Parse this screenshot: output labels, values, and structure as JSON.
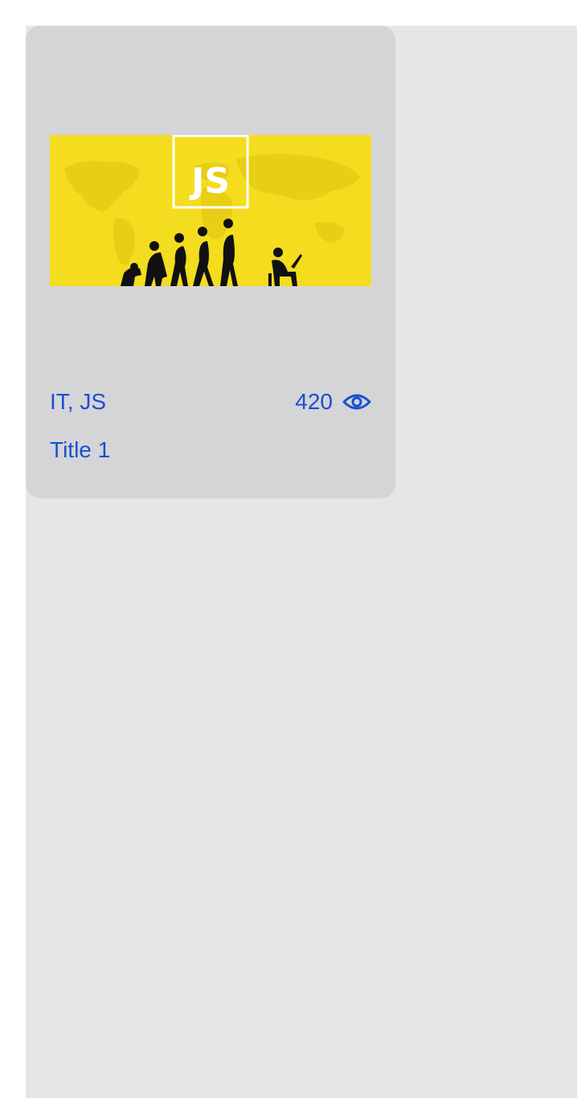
{
  "card": {
    "tags": "IT, JS",
    "views": "420",
    "title": "Title 1",
    "image": {
      "badge_text": "JS",
      "icon": "js-evolution-illustration",
      "background_color": "#f4dc1e"
    }
  },
  "colors": {
    "page_background": "#e6e6e8",
    "card_background": "#d5d5d8",
    "text_accent": "#1a4fcf"
  },
  "icons": {
    "views": "eye-icon"
  }
}
